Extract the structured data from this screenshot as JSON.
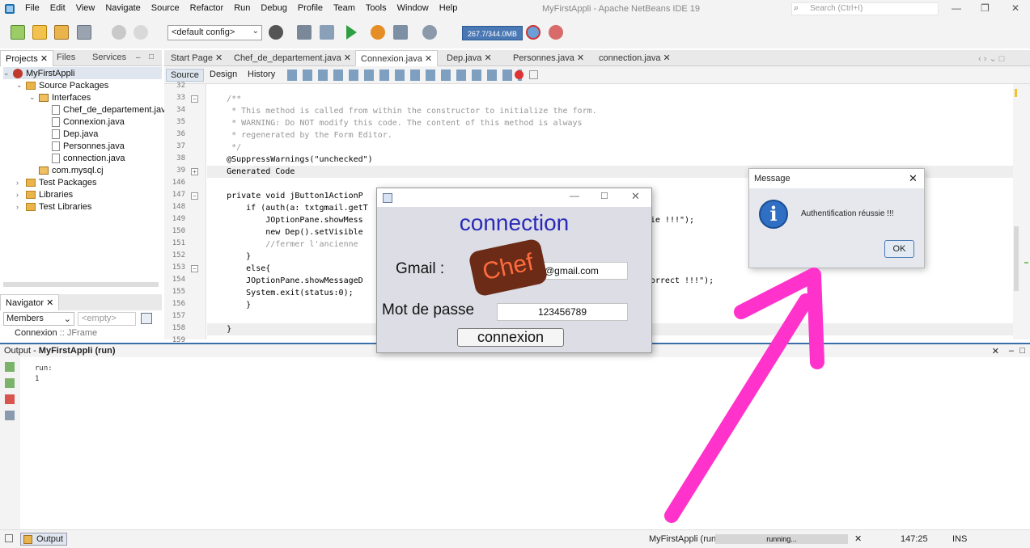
{
  "window": {
    "title": "MyFirstAppli - Apache NetBeans IDE 19",
    "search_placeholder": "Search (Ctrl+I)"
  },
  "menu": [
    "File",
    "Edit",
    "View",
    "Navigate",
    "Source",
    "Refactor",
    "Run",
    "Debug",
    "Profile",
    "Team",
    "Tools",
    "Window",
    "Help"
  ],
  "toolbar": {
    "config": "<default config>",
    "memory": "267.7/344.0MB"
  },
  "projects_panel": {
    "tabs": [
      "Projects",
      "Files",
      "Services"
    ],
    "tree": [
      {
        "label": "MyFirstAppli",
        "level": 0,
        "type": "project"
      },
      {
        "label": "Source Packages",
        "level": 1,
        "type": "folder"
      },
      {
        "label": "Interfaces",
        "level": 2,
        "type": "package"
      },
      {
        "label": "Chef_de_departement.java",
        "level": 3,
        "type": "file"
      },
      {
        "label": "Connexion.java",
        "level": 3,
        "type": "file"
      },
      {
        "label": "Dep.java",
        "level": 3,
        "type": "file"
      },
      {
        "label": "Personnes.java",
        "level": 3,
        "type": "file"
      },
      {
        "label": "connection.java",
        "level": 3,
        "type": "file"
      },
      {
        "label": "com.mysql.cj",
        "level": 2,
        "type": "package"
      },
      {
        "label": "Test Packages",
        "level": 1,
        "type": "folder"
      },
      {
        "label": "Libraries",
        "level": 1,
        "type": "folder"
      },
      {
        "label": "Test Libraries",
        "level": 1,
        "type": "folder"
      }
    ]
  },
  "navigator": {
    "title": "Navigator",
    "members": "Members",
    "empty": "<empty>",
    "item": "Connexion",
    "item_type": " :: JFrame"
  },
  "editor": {
    "tabs": [
      "Start Page",
      "Chef_de_departement.java",
      "Connexion.java",
      "Dep.java",
      "Personnes.java",
      "connection.java"
    ],
    "active_tab": "Connexion.java",
    "source_buttons": [
      "Source",
      "Design",
      "History"
    ],
    "line_numbers": [
      "32",
      "33",
      "34",
      "35",
      "36",
      "37",
      "38",
      "39",
      "146",
      "147",
      "148",
      "149",
      "150",
      "151",
      "152",
      "153",
      "154",
      "155",
      "156",
      "157",
      "158",
      "159"
    ],
    "lines": [
      "",
      "    /**",
      "     * This method is called from within the constructor to initialize the form.",
      "     * WARNING: Do NOT modify this code. The content of this method is always",
      "     * regenerated by the Form Editor.",
      "     */",
      "    @SuppressWarnings(\"unchecked\")",
      "    Generated Code",
      "",
      "    private void jButton1ActionP",
      "        if (auth(a: txtgmail.getT                                                       ",
      "            JOptionPane.showMess                                                      réussie !!!\");",
      "            new Dep().setVisible",
      "            //fermer l'ancienne",
      "        }",
      "        else{",
      "        JOptionPane.showMessageD                                                      e incorrect !!!\");",
      "        System.exit(status:0);",
      "        }",
      "",
      "    }",
      ""
    ]
  },
  "output": {
    "title": "Output - ",
    "project": "MyFirstAppli (run)",
    "lines": [
      "run:",
      "1"
    ]
  },
  "status": {
    "output_tab": "Output",
    "run_label": "MyFirstAppli (run)",
    "progress": "running...",
    "position": "147:25",
    "mode": "INS"
  },
  "login_frame": {
    "title": "connection",
    "gmail_label": "Gmail :",
    "gmail_value": "@gmail.com",
    "password_label": "Mot de passe",
    "password_value": "123456789",
    "button": "connexion",
    "sticker": "Chef"
  },
  "message_dialog": {
    "title": "Message",
    "text": "Authentification réussie !!!",
    "ok": "OK",
    "icon": "info-icon"
  },
  "colors": {
    "arrow": "#ff33cc",
    "title_blue": "#2a2ab8",
    "accent": "#3b6ea8"
  }
}
